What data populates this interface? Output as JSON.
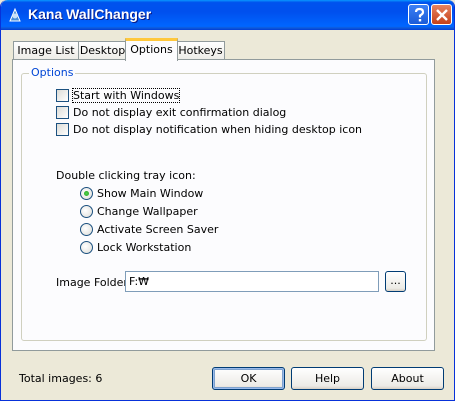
{
  "window": {
    "title": "Kana WallChanger",
    "icons": {
      "app": "app-icon",
      "help": "help-icon",
      "close": "close-icon"
    }
  },
  "tabs": [
    {
      "label": "Image List",
      "active": false
    },
    {
      "label": "Desktop",
      "active": false
    },
    {
      "label": "Options",
      "active": true
    },
    {
      "label": "Hotkeys",
      "active": false
    }
  ],
  "options_group": {
    "label": "Options",
    "checkboxes": [
      {
        "label": "Start with Windows",
        "checked": false
      },
      {
        "label": "Do not display exit confirmation dialog",
        "checked": false
      },
      {
        "label": "Do not display notification when hiding desktop icon",
        "checked": false
      }
    ],
    "tray_label": "Double clicking tray icon:",
    "radios": [
      {
        "label": "Show Main Window",
        "selected": true
      },
      {
        "label": "Change Wallpaper",
        "selected": false
      },
      {
        "label": "Activate Screen Saver",
        "selected": false
      },
      {
        "label": "Lock Workstation",
        "selected": false
      }
    ],
    "image_folder_label": "Image Folder:",
    "image_folder_value": "F:₩",
    "browse_label": "..."
  },
  "status": {
    "total_images": "Total images: 6"
  },
  "buttons": {
    "ok": "OK",
    "help": "Help",
    "about": "About"
  },
  "colors": {
    "titlebar": "#0054E3",
    "group_label": "#0046D5",
    "face": "#ECE9D8",
    "tab_highlight": "#FFC83C"
  }
}
